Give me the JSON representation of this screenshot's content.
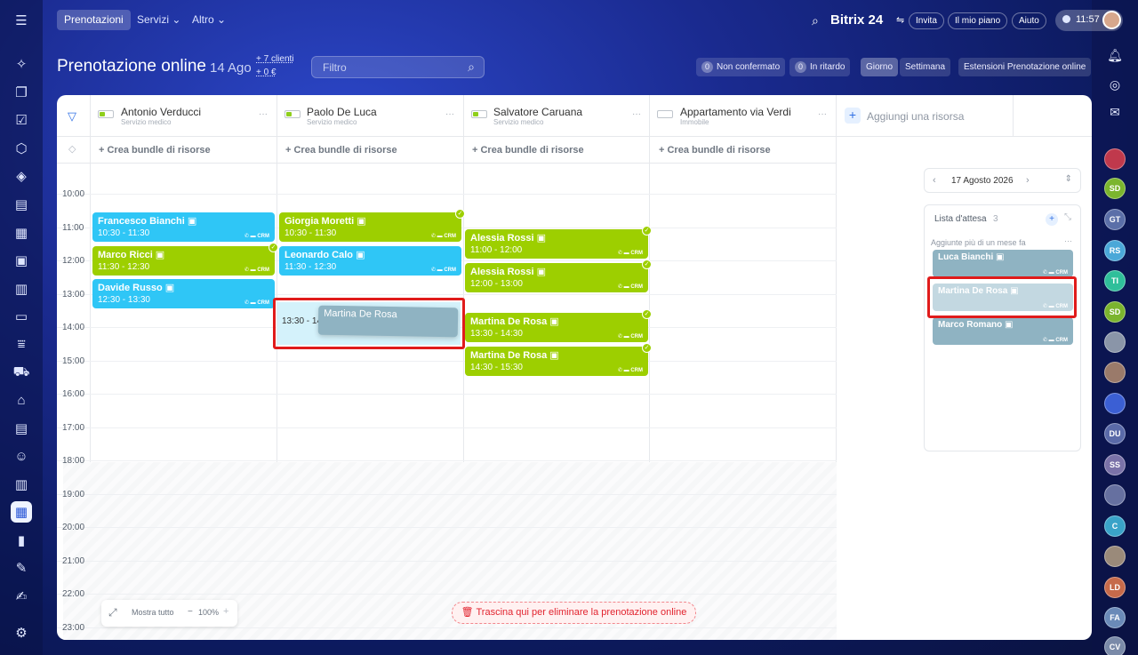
{
  "topbar": {
    "nav": [
      "Prenotazioni",
      "Servizi",
      "Altro"
    ],
    "brand": "Bitrix 24",
    "invite": "Invita",
    "plan": "Il mio piano",
    "help": "Aiuto",
    "time": "11:57"
  },
  "header": {
    "title": "Prenotazione online",
    "date": "14 Ago",
    "clients": "+ 7 clienti",
    "revenue": "+ 0 €",
    "filter_placeholder": "Filtro",
    "unconfirmed_count": "0",
    "unconfirmed": "Non confermato",
    "late_count": "0",
    "late": "In ritardo",
    "view_day": "Giorno",
    "view_week": "Settimana",
    "extensions": "Estensioni Prenotazione online"
  },
  "resources": [
    {
      "name": "Antonio Verducci",
      "sub": "Servizio medico"
    },
    {
      "name": "Paolo De Luca",
      "sub": "Servizio medico"
    },
    {
      "name": "Salvatore Caruana",
      "sub": "Servizio medico"
    },
    {
      "name": "Appartamento via Verdi",
      "sub": "Immobile"
    }
  ],
  "add_resource": "Aggiungi una risorsa",
  "bundle_label": "+ Crea bundle di risorse",
  "hours": [
    "10:00",
    "11:00",
    "12:00",
    "13:00",
    "14:00",
    "15:00",
    "16:00",
    "17:00",
    "18:00",
    "19:00",
    "20:00",
    "21:00",
    "22:00",
    "23:00"
  ],
  "bookings": [
    {
      "name": "Francesco Bianchi",
      "time": "10:30 - 11:30",
      "crm": "CRM"
    },
    {
      "name": "Marco Ricci",
      "time": "11:30 - 12:30",
      "crm": "CRM"
    },
    {
      "name": "Davide Russo",
      "time": "12:30 - 13:30",
      "crm": "CRM"
    },
    {
      "name": "Giorgia Moretti",
      "time": "10:30 - 11:30",
      "crm": "CRM"
    },
    {
      "name": "Leonardo Calo",
      "time": "11:30 - 12:30",
      "crm": "CRM"
    },
    {
      "name": "Alessia Rossi",
      "time": "11:00 - 12:00",
      "crm": "CRM"
    },
    {
      "name": "Alessia Rossi",
      "time": "12:00 - 13:00",
      "crm": "CRM"
    },
    {
      "name": "Martina De Rosa",
      "time": "13:30 - 14:30",
      "crm": "CRM"
    },
    {
      "name": "Martina De Rosa",
      "time": "14:30 - 15:30",
      "crm": "CRM"
    }
  ],
  "drag": {
    "slot_time": "13:30 - 14",
    "name": "Martina De Rosa"
  },
  "side": {
    "date": "17 Agosto 2026",
    "waitlist_title": "Lista d'attesa",
    "waitlist_count": "3",
    "waitlist_note": "Aggiunte più di un mese fa",
    "waitlist": [
      "Luca Bianchi",
      "Martina De Rosa",
      "Marco Romano"
    ]
  },
  "footer": {
    "show_all": "Mostra tutto",
    "zoom": "100%",
    "delete_zone": "Trascina qui per eliminare la prenotazione online"
  },
  "right_rail_avatars": [
    "SD",
    "GT",
    "RS",
    "TI",
    "SD",
    "DU",
    "SS",
    "C",
    "LD",
    "FA",
    "CV"
  ]
}
